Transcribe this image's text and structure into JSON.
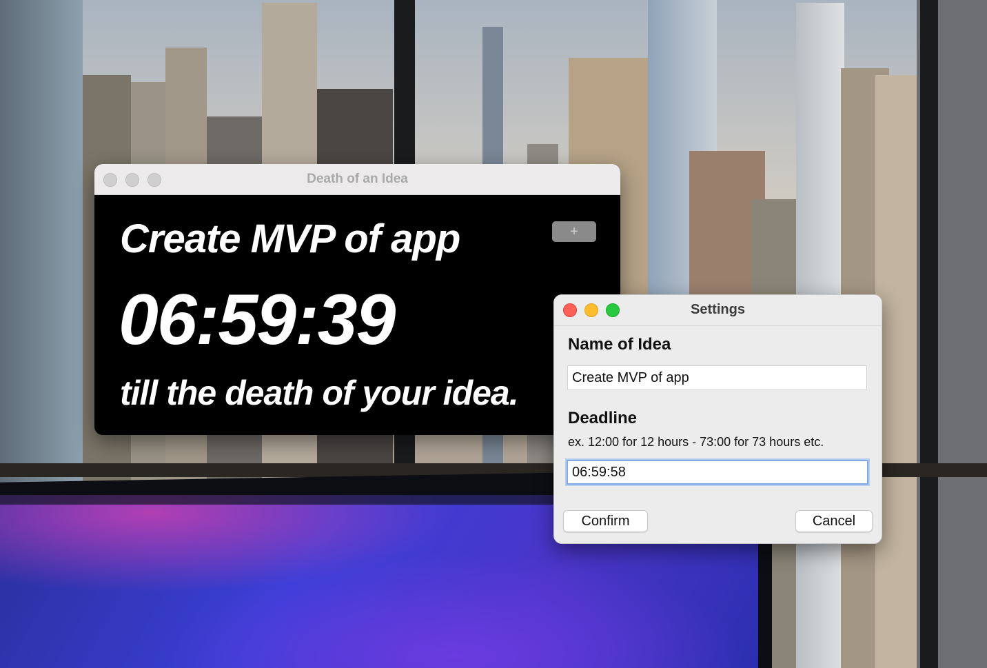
{
  "main_window": {
    "title": "Death of an Idea",
    "idea_name": "Create MVP of app",
    "countdown": "06:59:39",
    "subtitle": "till the death of your idea.",
    "add_button_label": "+"
  },
  "settings_window": {
    "title": "Settings",
    "name_label": "Name of Idea",
    "name_value": "Create MVP of app",
    "deadline_label": "Deadline",
    "deadline_hint": "ex. 12:00 for 12 hours -  73:00 for 73 hours etc.",
    "deadline_value": "06:59:58",
    "confirm_label": "Confirm",
    "cancel_label": "Cancel"
  },
  "colors": {
    "traffic_close": "#fe5f57",
    "traffic_minimize": "#febc2e",
    "traffic_zoom": "#28c840",
    "focus_ring": "#7fa8e6"
  }
}
